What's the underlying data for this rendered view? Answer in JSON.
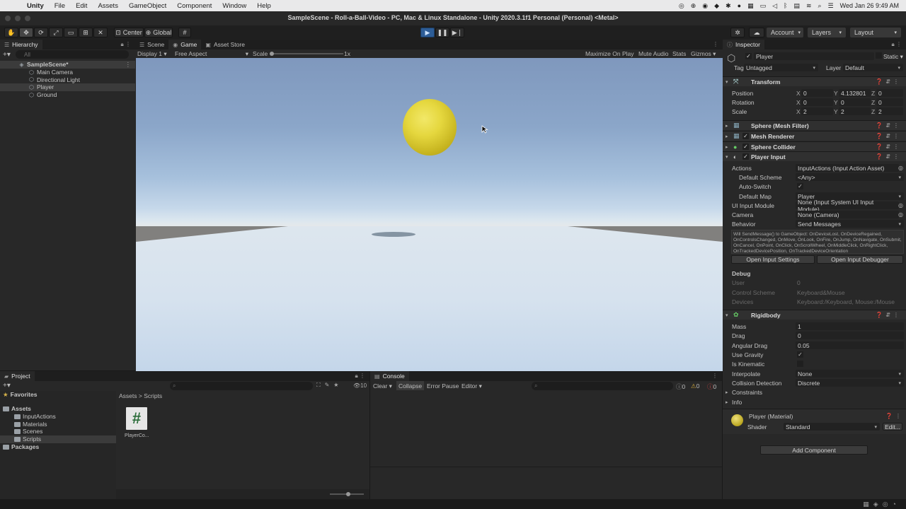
{
  "menubar": {
    "items": [
      "Unity",
      "File",
      "Edit",
      "Assets",
      "GameObject",
      "Component",
      "Window",
      "Help"
    ],
    "datetime": "Wed Jan 26  9:49 AM"
  },
  "window": {
    "title": "SampleScene - Roll-a-Ball-Video - PC, Mac & Linux Standalone - Unity 2020.3.1f1 Personal (Personal) <Metal>"
  },
  "toolbar": {
    "pivot": "Center",
    "space": "Global",
    "account": "Account",
    "layers": "Layers",
    "layout": "Layout"
  },
  "hierarchy": {
    "tab": "Hierarchy",
    "search_placeholder": "All",
    "scene": "SampleScene*",
    "items": [
      "Main Camera",
      "Directional Light",
      "Player",
      "Ground"
    ]
  },
  "center_tabs": [
    "Scene",
    "Game",
    "Asset Store"
  ],
  "gamebar": {
    "display": "Display 1",
    "aspect": "Free Aspect",
    "scale_label": "Scale",
    "scale_value": "1x",
    "maximize": "Maximize On Play",
    "mute": "Mute Audio",
    "stats": "Stats",
    "gizmos": "Gizmos"
  },
  "inspector": {
    "tab": "Inspector",
    "object_name": "Player",
    "static_label": "Static",
    "tag_label": "Tag",
    "tag": "Untagged",
    "layer_label": "Layer",
    "layer": "Default",
    "transform": {
      "name": "Transform",
      "position_label": "Position",
      "rotation_label": "Rotation",
      "scale_label": "Scale",
      "position": [
        "0",
        "4.132801",
        "0"
      ],
      "rotation": [
        "0",
        "0",
        "0"
      ],
      "scale": [
        "2",
        "2",
        "2"
      ]
    },
    "components": [
      "Sphere (Mesh Filter)",
      "Mesh Renderer",
      "Sphere Collider",
      "Player Input"
    ],
    "player_input": {
      "actions_label": "Actions",
      "actions": "InputActions (Input Action Asset)",
      "default_scheme_label": "Default Scheme",
      "default_scheme": "<Any>",
      "auto_switch_label": "Auto-Switch",
      "default_map_label": "Default Map",
      "default_map": "Player",
      "ui_input_label": "UI Input Module",
      "ui_input": "None (Input System UI Input Module)",
      "camera_label": "Camera",
      "camera": "None (Camera)",
      "behavior_label": "Behavior",
      "behavior": "Send Messages",
      "help_text": "Will SendMessage() to GameObject: OnDeviceLost, OnDeviceRegained, OnControlsChanged, OnMove, OnLook, OnFire, OnJump, OnNavigate, OnSubmit, OnCancel, OnPoint, OnClick, OnScrollWheel, OnMiddleClick, OnRightClick, OnTrackedDevicePosition, OnTrackedDeviceOrientation",
      "open_settings": "Open Input Settings",
      "open_debugger": "Open Input Debugger",
      "debug_label": "Debug",
      "user_label": "User",
      "user": "0",
      "control_scheme_label": "Control Scheme",
      "control_scheme": "Keyboard&Mouse",
      "devices_label": "Devices",
      "devices": "Keyboard:/Keyboard, Mouse:/Mouse"
    },
    "rigidbody": {
      "name": "Rigidbody",
      "mass_label": "Mass",
      "mass": "1",
      "drag_label": "Drag",
      "drag": "0",
      "angular_drag_label": "Angular Drag",
      "angular_drag": "0.05",
      "use_gravity_label": "Use Gravity",
      "is_kinematic_label": "Is Kinematic",
      "interpolate_label": "Interpolate",
      "interpolate": "None",
      "collision_label": "Collision Detection",
      "collision": "Discrete",
      "constraints_label": "Constraints",
      "info_label": "Info"
    },
    "material": {
      "name": "Player (Material)",
      "shader_label": "Shader",
      "shader": "Standard",
      "edit": "Edit..."
    },
    "add_component": "Add Component"
  },
  "project": {
    "tab": "Project",
    "favorites": "Favorites",
    "assets": "Assets",
    "folders": [
      "InputActions",
      "Materials",
      "Scenes",
      "Scripts"
    ],
    "packages": "Packages",
    "breadcrumb": [
      "Assets",
      "Scripts"
    ],
    "file_label": "PlayerCo...",
    "count": "10"
  },
  "console": {
    "tab": "Console",
    "clear": "Clear",
    "collapse": "Collapse",
    "error_pause": "Error Pause",
    "editor": "Editor",
    "counts": [
      "0",
      "0",
      "0"
    ]
  },
  "colors": {
    "accent": "#2d74c7",
    "panel": "#282828",
    "ball": "#e5d73e"
  }
}
